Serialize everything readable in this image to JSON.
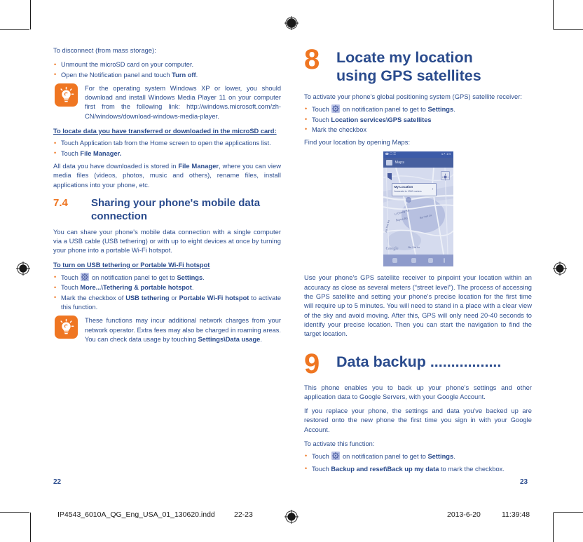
{
  "document": {
    "slug_filename": "IP4543_6010A_QG_Eng_USA_01_130620.indd",
    "slug_pages": "22-23",
    "slug_date": "2013-6-20",
    "slug_time": "11:39:48",
    "accent_orange": "#ef7622",
    "text_blue": "#2a4b8d"
  },
  "left_page": {
    "page_number": "22",
    "intro": "To disconnect (from mass storage):",
    "disconnect_bullets": [
      {
        "text": "Unmount the microSD card on your computer.",
        "bold": ""
      },
      {
        "pre": "Open the Notification panel and touch ",
        "bold": "Turn off",
        "post": "."
      }
    ],
    "tip1": {
      "icon": "lightbulb-icon",
      "text": "For the operating system Windows XP or lower, you should download and install Windows Media Player 11 on your computer first from the following link: http://windows.microsoft.com/zh-CN/windows/download-windows-media-player."
    },
    "locate_heading": "To locate data you have transferred or downloaded in the microSD card:",
    "locate_bullets": [
      {
        "pre": "Touch Application tab from the Home screen to open the applications list.",
        "bold": "",
        "post": ""
      },
      {
        "pre": "Touch ",
        "bold": "File Manager.",
        "post": ""
      }
    ],
    "locate_paragraph_pre": "All data you have downloaded is stored in ",
    "locate_paragraph_bold": "File Manager",
    "locate_paragraph_post": ", where you can view media files (videos, photos, music and others), rename files, install applications into your phone, etc.",
    "section": {
      "number": "7.4",
      "title": "Sharing your phone's mobile data connection"
    },
    "section_paragraph": "You can share your phone's mobile data connection with a single computer via a USB cable (USB tethering) or with up to eight devices at once by turning your phone into a portable Wi-Fi hotspot.",
    "tether_heading": "To turn on USB tethering or Portable Wi-Fi hotspot",
    "tether_bullets": [
      {
        "pre": "Touch ",
        "icon": "settings-gear-icon",
        "mid": " on notification panel to get to ",
        "bold": "Settings",
        "post": "."
      },
      {
        "pre": "Touch ",
        "bold": "More...\\Tethering & portable hotspot",
        "post": "."
      },
      {
        "pre": "Mark the checkbox of ",
        "bold": "USB tethering",
        "mid2": " or ",
        "bold2": "Portable Wi-Fi hotspot",
        "post": " to activate this function."
      }
    ],
    "tip2": {
      "icon": "lightbulb-icon",
      "pre": "These functions may incur additional network charges from your network operator. Extra fees may also be charged in roaming areas. You can check data usage by touching ",
      "bold": "Settings\\Data usage",
      "post": "."
    }
  },
  "right_page": {
    "page_number": "23",
    "chapter8": {
      "number": "8",
      "title_line1": "Locate my location",
      "title_line2": "using GPS satellites"
    },
    "gps_intro": "To activate your phone's global positioning system (GPS) satellite receiver:",
    "gps_bullets": [
      {
        "pre": "Touch ",
        "icon": "settings-gear-icon",
        "mid": " on notification panel to get to ",
        "bold": "Settings",
        "post": "."
      },
      {
        "pre": "Touch ",
        "bold": "Location services\\GPS satellites",
        "post": ""
      },
      {
        "pre": "Mark the checkbox",
        "bold": "",
        "post": ""
      }
    ],
    "gps_find": "Find your location by opening Maps:",
    "phone_screenshot": {
      "status_left": "icons-signal-battery",
      "status_right": "17:24",
      "app_title": "Maps",
      "callout_title": "My Location",
      "callout_subtitle": "Accurate to 1300 meters",
      "callout_arrow": "›",
      "attribution": "Google",
      "street_labels": [
        "Li Chang Rd",
        "Boyun Rd",
        "Bo Yun Lu",
        "Bo Xia Lu",
        "Da Xue Lu",
        "Cao Xi Lu"
      ],
      "locate_button": "my-location-button",
      "nav_icons": [
        "search-icon",
        "directions-icon",
        "layers-icon",
        "overflow-icon"
      ]
    },
    "gps_paragraph": "Use your phone's GPS satellite receiver to pinpoint your location within an accuracy as close as several meters (“street level”). The process of accessing the GPS satellite and setting your phone's precise location for the first time will require up to 5 minutes. You will need to stand in a place with a clear view of the sky and avoid moving. After this, GPS will only need 20-40 seconds to identify your precise location. Then you can start the navigation to find the target location.",
    "chapter9": {
      "number": "9",
      "title": "Data backup ................."
    },
    "backup_paragraph1": "This phone enables you to back up your phone's settings and other application data to Google Servers, with your Google Account.",
    "backup_paragraph2": "If you replace your phone, the settings and data you've backed up are restored onto the new phone the first time you sign in with your Google Account.",
    "backup_activate": "To activate this function:",
    "backup_bullets": [
      {
        "pre": "Touch ",
        "icon": "settings-gear-icon",
        "mid": " on notification panel to get to ",
        "bold": "Settings",
        "post": "."
      },
      {
        "pre": "Touch ",
        "bold": "Backup and reset\\Back up my data",
        "post": " to mark the checkbox."
      }
    ]
  }
}
